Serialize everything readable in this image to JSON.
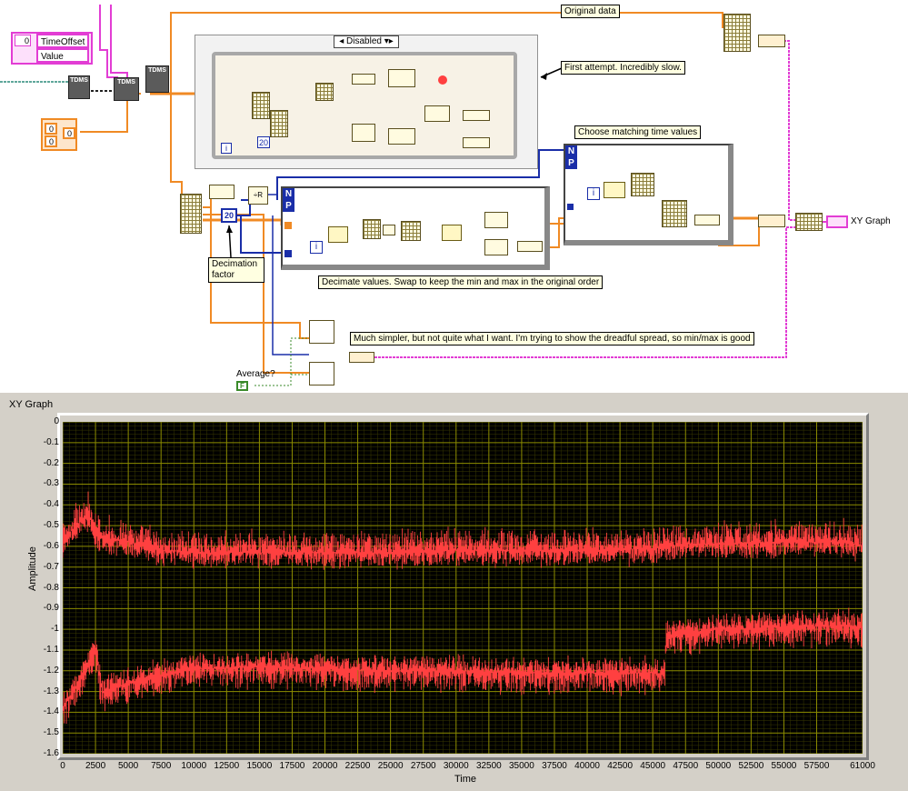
{
  "diagram": {
    "cluster_elements": [
      "TimeOffset",
      "Value"
    ],
    "cluster_index": "0",
    "array_values": [
      "0",
      "0"
    ],
    "array_index": "0",
    "tdms_label": "TDMS",
    "disabled_selector": "Disabled",
    "decimation_constant": "20",
    "loop_constant": "20",
    "average_bool": "F",
    "xy_graph_terminal": "XY Graph",
    "np_n": "N",
    "np_p": "P",
    "iter_i": "i",
    "divide_label": "R",
    "notes": {
      "original_data": "Original data",
      "first_attempt": "First attempt. Incredibly slow.",
      "choose_matching": "Choose matching time values",
      "decimation_factor_1": "Decimation",
      "decimation_factor_2": "factor",
      "decimate_values": "Decimate values. Swap to keep the min and max in the original order",
      "much_simpler": "Much simpler, but not quite what I want. I'm trying to show the dreadful spread, so min/max is good",
      "average": "Average?"
    }
  },
  "graph": {
    "title": "XY Graph",
    "colors": {
      "background": "#000000",
      "grid": "#8c8c00",
      "plot": "#ff4040",
      "panel": "#d4d0c8"
    }
  },
  "chart_data": {
    "type": "line",
    "title": "XY Graph",
    "xlabel": "Time",
    "ylabel": "Amplitude",
    "xlim": [
      0,
      61000
    ],
    "ylim": [
      -1.6,
      0
    ],
    "grid": true,
    "x_ticks": [
      "0",
      "2500",
      "5000",
      "7500",
      "10000",
      "12500",
      "15000",
      "17500",
      "20000",
      "22500",
      "25000",
      "27500",
      "30000",
      "32500",
      "35000",
      "37500",
      "40000",
      "42500",
      "45000",
      "47500",
      "50000",
      "52500",
      "55000",
      "57500",
      "61000"
    ],
    "y_ticks": [
      "0",
      "-0.1",
      "-0.2",
      "-0.3",
      "-0.4",
      "-0.5",
      "-0.6",
      "-0.7",
      "-0.8",
      "-0.9",
      "-1",
      "-1.1",
      "-1.2",
      "-1.3",
      "-1.4",
      "-1.5",
      "-1.6"
    ],
    "series": [
      {
        "role": "max",
        "x": [
          0,
          1000,
          2000,
          2500,
          3000,
          5000,
          7500,
          10000,
          15000,
          20000,
          25000,
          30000,
          35000,
          40000,
          45000,
          47500,
          50000,
          55000,
          60000,
          61000
        ],
        "y": [
          -0.58,
          -0.5,
          -0.45,
          -0.55,
          -0.56,
          -0.58,
          -0.62,
          -0.63,
          -0.63,
          -0.63,
          -0.63,
          -0.62,
          -0.62,
          -0.62,
          -0.61,
          -0.59,
          -0.59,
          -0.58,
          -0.58,
          -0.6
        ]
      },
      {
        "role": "min",
        "x": [
          0,
          1000,
          2000,
          2500,
          3000,
          5000,
          7500,
          10000,
          15000,
          20000,
          25000,
          30000,
          35000,
          40000,
          45000,
          45900,
          46000,
          47500,
          50000,
          55000,
          60000,
          61000
        ],
        "y": [
          -1.38,
          -1.28,
          -1.15,
          -1.1,
          -1.3,
          -1.26,
          -1.22,
          -1.19,
          -1.18,
          -1.19,
          -1.2,
          -1.2,
          -1.21,
          -1.21,
          -1.21,
          -1.22,
          -1.03,
          -1.02,
          -1.0,
          -0.99,
          -0.98,
          -0.99
        ]
      }
    ]
  }
}
